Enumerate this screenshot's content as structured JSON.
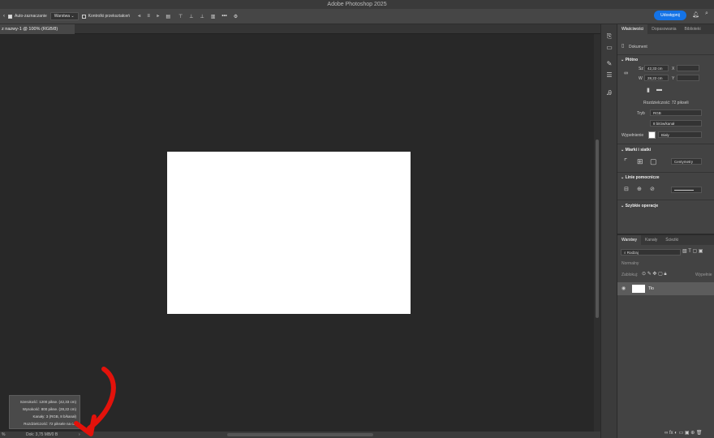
{
  "window": {
    "title": "Adobe Photoshop 2025"
  },
  "options_bar": {
    "auto_select_label": "Auto-zaznaczanie",
    "auto_select_target": "Warstwa",
    "transform_controls_label": "Kontrolki przekształceń",
    "more_label": "•••",
    "share_label": "Udostępnij"
  },
  "document": {
    "tab_title": "z nazwy-1 @ 100% (RGB/8)"
  },
  "status": {
    "doc_size": "Dok: 3,75 MB/0 B"
  },
  "info_tooltip": {
    "lines": [
      "Szerokość: 1200 pikse. (42,33 cm)",
      "Wysokość: 800 pikse. (28,22 cm)",
      "Kanały: 3 (RGB, 8 b/kanał)",
      "Rozdzielczość: 72 piksele na cal"
    ]
  },
  "properties_panel": {
    "tabs": [
      "Właściwości",
      "Dopasowania",
      "Biblioteki"
    ],
    "active_tab": "Właściwości",
    "doc_label": "Dokument",
    "canvas_section": "Płótno",
    "width_label": "Sz",
    "width_value": "42,33 cm",
    "x_label": "X",
    "height_label": "W",
    "height_value": "28,22 cm",
    "y_label": "Y",
    "resolution": "Rozdzielczość: 72 pikseli",
    "mode_label": "Tryb",
    "mode_value": "RGB",
    "bit_depth": "8 bitów/kanał",
    "fill_label": "Wypełnienie",
    "fill_value": "Biały",
    "rulers_section": "Miarki i siatki",
    "units_value": "Centymetry",
    "guides_section": "Linie pomocnicze",
    "quick_actions_section": "Szybkie operacje"
  },
  "layers_panel": {
    "tabs": [
      "Warstwy",
      "Kanały",
      "Ścieżki"
    ],
    "active_tab": "Warstwy",
    "search_placeholder": "Rodzaj",
    "blend_mode": "Normalny",
    "lock_label": "Zablokuj:",
    "opacity_label": "Wypełnie",
    "layers": [
      {
        "name": "Tło",
        "visible": true
      }
    ]
  },
  "colors": {
    "accent": "#1473e6",
    "annotation": "#e3120b"
  }
}
